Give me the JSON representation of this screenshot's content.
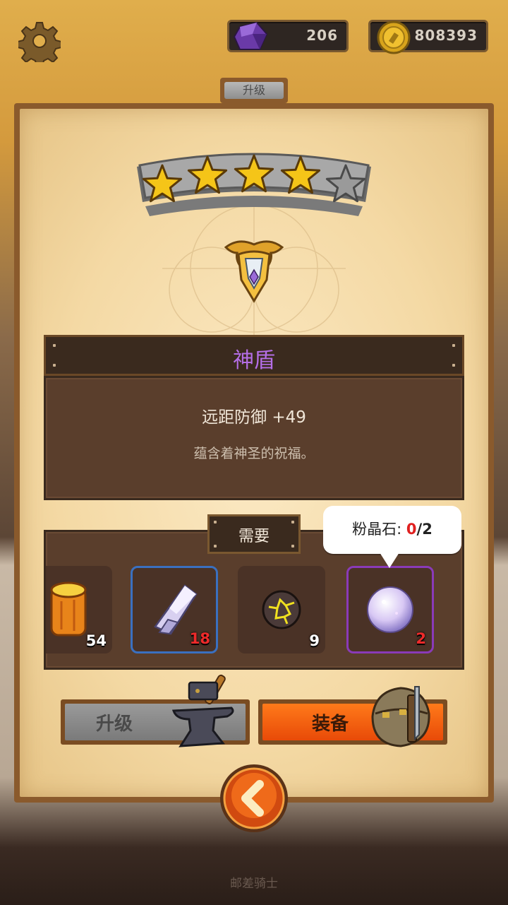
{
  "topbar": {
    "gems": "206",
    "coins": "808393",
    "icons": {
      "settings": "gear-icon",
      "gems": "purple-gem-icon",
      "coins": "gold-coin-icon"
    }
  },
  "panel": {
    "tab_label": "升级",
    "stars": {
      "filled": 4,
      "total": 5
    },
    "item_icon": "winged-shield-emblem-icon",
    "item_name": "神盾",
    "stat_line": "远距防御 +49",
    "flavor_text": "蕴含着神圣的祝福。"
  },
  "requirements": {
    "label": "需要",
    "slots": [
      {
        "icon": "gold-ingot-icon",
        "count": "54",
        "rarity": "none"
      },
      {
        "icon": "crystal-shard-icon",
        "count": "18",
        "rarity": "blue"
      },
      {
        "icon": "cracked-lava-stone-icon",
        "count": "9",
        "rarity": "none"
      },
      {
        "icon": "pink-crystal-orb-icon",
        "count": "2",
        "rarity": "purple"
      }
    ],
    "tooltip": {
      "name": "粉晶石:",
      "have": "0",
      "need": "/2"
    }
  },
  "actions": {
    "upgrade_label": "升级",
    "equip_label": "装备"
  },
  "footer": {
    "text": "邮差骑士"
  },
  "colors": {
    "item_name": "#b46ee6",
    "equip_button": "#f05a10",
    "upgrade_button": "#8c8c8c",
    "insufficient": "#e02020",
    "star_gold": "#f5c518"
  }
}
